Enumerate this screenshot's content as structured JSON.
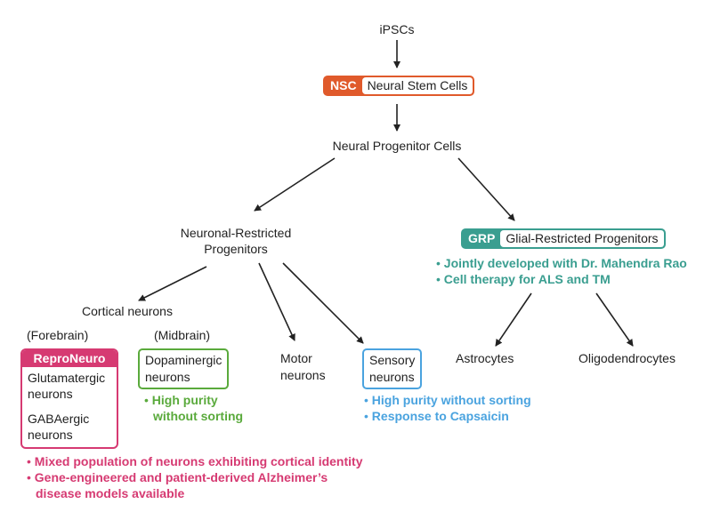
{
  "colors": {
    "nsc": "#e05a2b",
    "grp": "#3a9e90",
    "repro": "#d63a72",
    "dopa": "#5aaa3c",
    "sensory": "#4aa3df",
    "arrow": "#222222"
  },
  "nodes": {
    "ipscs": "iPSCs",
    "nsc": {
      "tag": "NSC",
      "label": "Neural Stem Cells"
    },
    "npc": "Neural Progenitor Cells",
    "nrp": [
      "Neuronal-Restricted",
      "Progenitors"
    ],
    "grp": {
      "tag": "GRP",
      "label": "Glial-Restricted Progenitors"
    },
    "cortical": "Cortical neurons",
    "forebrain": "(Forebrain)",
    "midbrain": "(Midbrain)",
    "repro": {
      "title": "ReproNeuro",
      "items": [
        [
          "Glutamatergic",
          "neurons"
        ],
        [
          "GABAergic",
          "neurons"
        ]
      ]
    },
    "dopa": [
      "Dopaminergic",
      "neurons"
    ],
    "motor": [
      "Motor",
      "neurons"
    ],
    "sensory": [
      "Sensory",
      "neurons"
    ],
    "astro": "Astrocytes",
    "oligo": "Oligodendrocytes"
  },
  "bullets": {
    "grp": [
      "Jointly developed with Dr. Mahendra Rao",
      "Cell therapy for ALS and TM"
    ],
    "dopa": [
      "High purity",
      "without sorting"
    ],
    "sensory": [
      "High purity without sorting",
      "Response to Capsaicin"
    ],
    "repro": [
      "Mixed population of neurons exhibiting cortical identity",
      "Gene-engineered and patient-derived Alzheimer’s",
      "disease models available"
    ]
  }
}
